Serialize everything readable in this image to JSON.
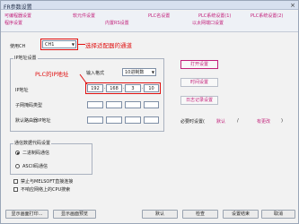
{
  "window": {
    "title": "FR参数设置",
    "close_glyph": "×"
  },
  "tabs": [
    {
      "label": "可编程器设置"
    },
    {
      "label": "软元件设置"
    },
    {
      "label": "PLC名设置"
    },
    {
      "label": "PLC系统设置(1)"
    },
    {
      "label": "PLC系统设置(2)"
    },
    {
      "label": "程序设置"
    },
    {
      "label": "内置RS设置"
    },
    {
      "label": "以太网端口设置"
    }
  ],
  "channel": {
    "label": "使用CH",
    "value": "CH1",
    "annotation": "选择适配器的通道"
  },
  "ip_group": {
    "title": "IP地址设置",
    "input_format_label": "输入格式",
    "input_format_value": "10进制数",
    "ip_label": "IP地址",
    "ip_annotation": "PLC的IP地址",
    "ip": [
      "192",
      "168",
      "3",
      "10"
    ],
    "subnet_label": "子网掩码类型",
    "gateway_label": "默认路由器IP地址"
  },
  "side_buttons": {
    "open_settings": "打开设置",
    "link_settings": "时间设置",
    "log_settings": "日志记录设置",
    "required_label": "必要时设置(",
    "required_none": "默认",
    "required_slash": "/",
    "required_exists": "有更改",
    "required_close": ")"
  },
  "comm": {
    "title": "通信数据代码设置",
    "binary": "二进制码通信",
    "ascii": "ASCII码通信",
    "melsoft": "禁止与MELSOFT直接连接",
    "oncheck": "不响应网络上的CPU搜索"
  },
  "footer": {
    "print": "显示画面打印...",
    "preview": "显示画面预览",
    "default": "默认",
    "check": "检查",
    "finish": "设置结束",
    "cancel": "取消"
  },
  "colors": {
    "accent": "#c21f7a",
    "annotation": "#e01010"
  }
}
